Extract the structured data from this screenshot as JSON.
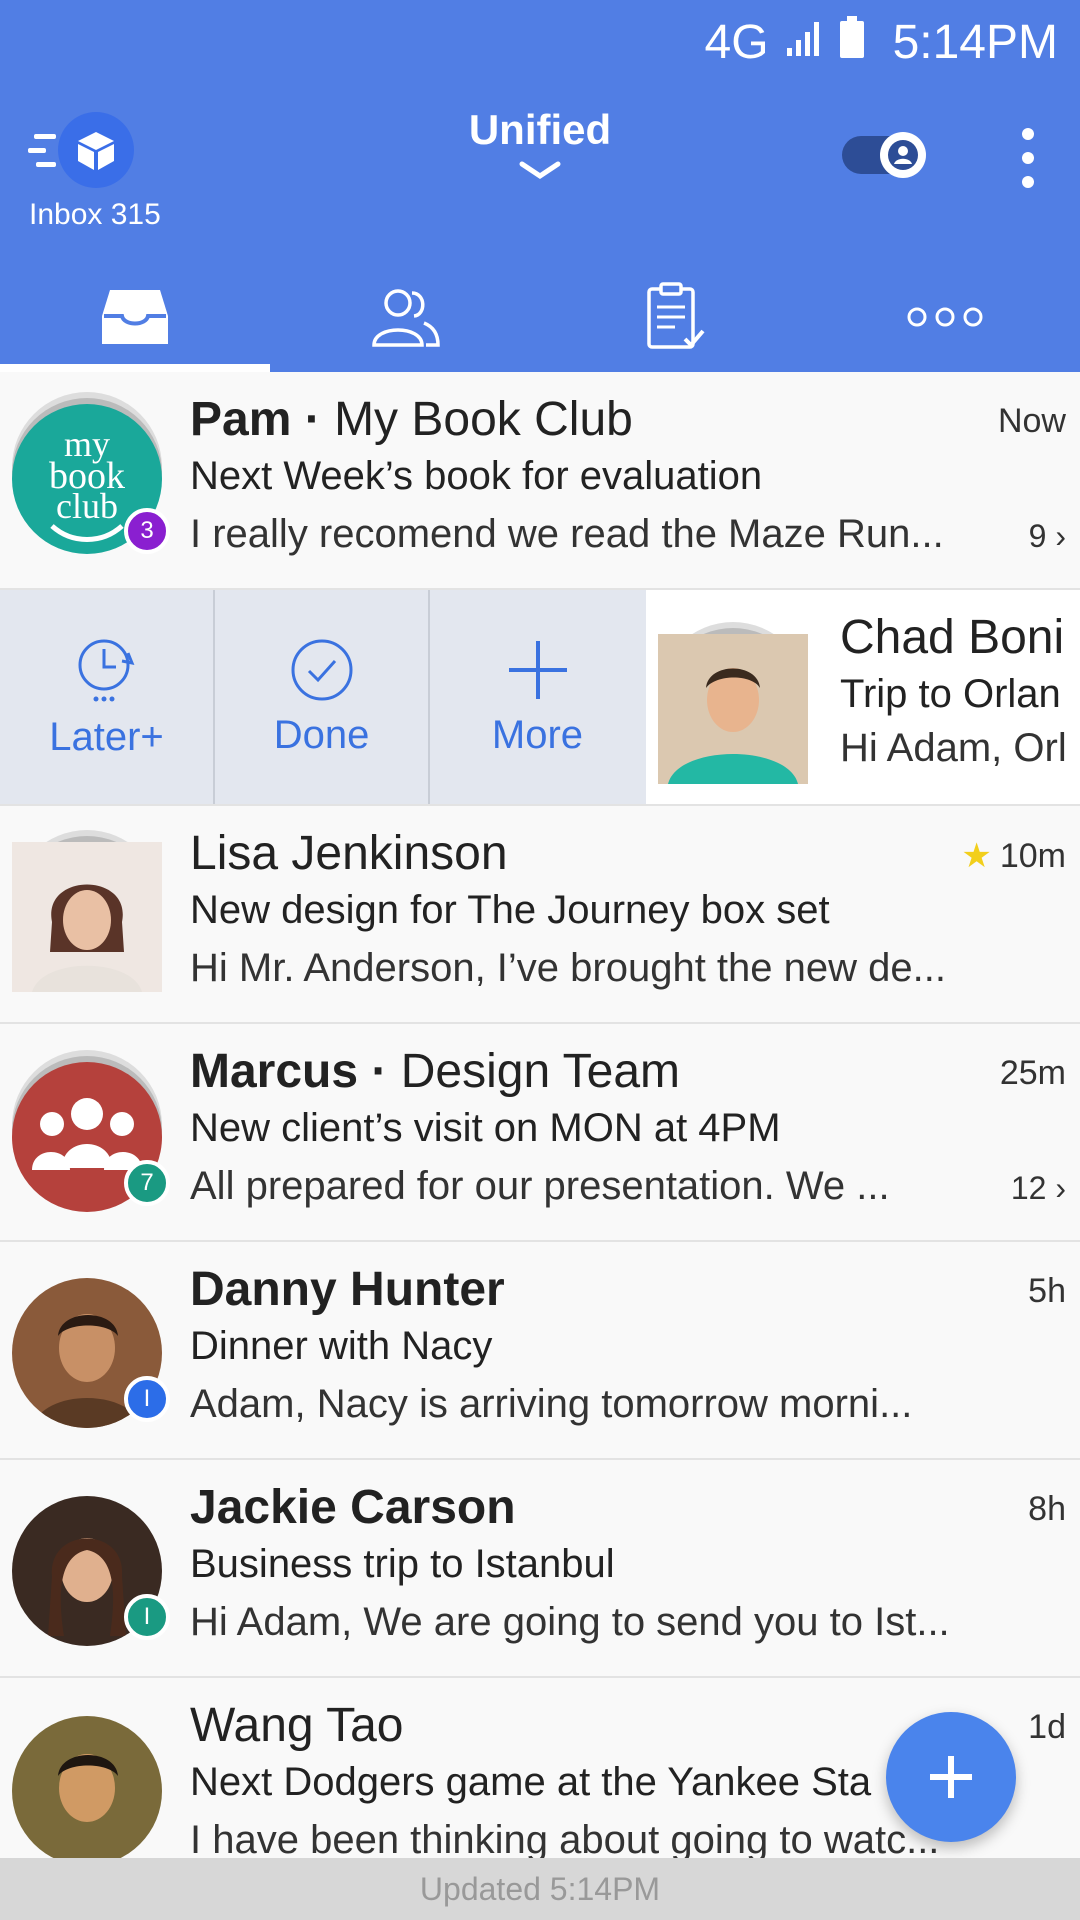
{
  "status_bar": {
    "network": "4G",
    "time": "5:14PM"
  },
  "header": {
    "inbox_label": "Inbox 315",
    "account_title": "Unified",
    "brand_color": "#517ee4"
  },
  "tabs": [
    {
      "name": "inbox",
      "icon": "inbox-tray-icon",
      "active": true
    },
    {
      "name": "people",
      "icon": "people-icon",
      "active": false
    },
    {
      "name": "tasks",
      "icon": "clipboard-check-icon",
      "active": false
    },
    {
      "name": "more",
      "icon": "more-dots-icon",
      "active": false
    }
  ],
  "emails": [
    {
      "sender": "Pam",
      "group": "My Book Club",
      "subject": "Next Week’s book for evaluation",
      "preview": "I really recomend we read the Maze Run...",
      "time": "Now",
      "thread_count": "9",
      "badge": "3",
      "badge_color": "#8a1fd0",
      "avatar_color": "#1aa89a"
    },
    {
      "sender": "Chad Boni",
      "subject": "Trip to Orlan",
      "preview": "Hi Adam, Orl",
      "avatar_color": "#23b8a4"
    },
    {
      "sender": "Lisa Jenkinson",
      "subject": "New design for The Journey box set",
      "preview": "Hi Mr. Anderson, I’ve brought the new de...",
      "time": "10m",
      "starred": true,
      "avatar_color": "#6d4a3a"
    },
    {
      "sender": "Marcus",
      "group": "Design Team",
      "subject": "New client’s visit on MON at 4PM",
      "preview": "All prepared for our presentation. We ...",
      "time": "25m",
      "thread_count": "12",
      "badge": "7",
      "badge_color": "#1a9a82",
      "avatar_color": "#b5413c"
    },
    {
      "sender": "Danny Hunter",
      "subject": "Dinner with Nacy",
      "preview": "Adam, Nacy is arriving tomorrow morni...",
      "time": "5h",
      "badge": "I",
      "badge_color": "#2c6de8",
      "avatar_color": "#7a4a2a"
    },
    {
      "sender": "Jackie Carson",
      "subject": "Business trip to Istanbul",
      "preview": "Hi Adam, We are going to send you to Ist...",
      "time": "8h",
      "badge": "I",
      "badge_color": "#1a9a82",
      "avatar_color": "#5b3a2a"
    },
    {
      "sender": "Wang Tao",
      "subject": "Next Dodgers game at the Yankee Sta",
      "preview": "I have been thinking about going to watc...",
      "time": "1d",
      "avatar_color": "#8a6a3a"
    }
  ],
  "swipe_actions": [
    {
      "label": "Later+",
      "icon": "clock-later-icon"
    },
    {
      "label": "Done",
      "icon": "check-circle-icon"
    },
    {
      "label": "More",
      "icon": "plus-icon"
    }
  ],
  "footer": {
    "updated": "Updated 5:14PM"
  },
  "fab": {
    "icon": "compose-plus-icon"
  }
}
